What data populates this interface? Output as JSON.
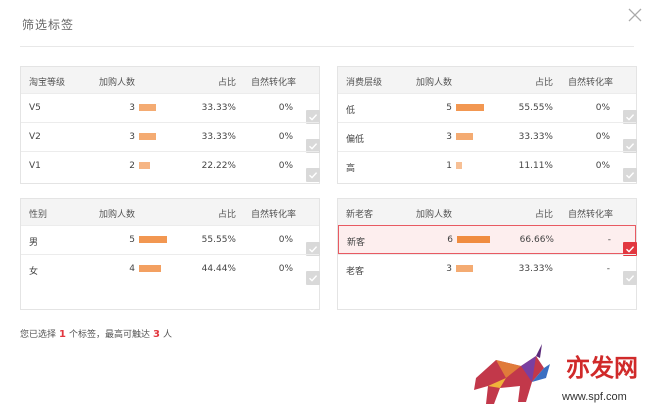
{
  "dialog": {
    "title": "筛选标签"
  },
  "panels": {
    "taobao": {
      "headers": [
        "淘宝等级",
        "加购人数",
        "占比",
        "自然转化率"
      ],
      "rows": [
        {
          "label": "V5",
          "count": "3",
          "pct": "33.33%",
          "rate": "0%",
          "share": 0.3333,
          "checked": false
        },
        {
          "label": "V2",
          "count": "3",
          "pct": "33.33%",
          "rate": "0%",
          "share": 0.3333,
          "checked": false
        },
        {
          "label": "V1",
          "count": "2",
          "pct": "22.22%",
          "rate": "0%",
          "share": 0.2222,
          "checked": false
        }
      ]
    },
    "consume": {
      "headers": [
        "消费层级",
        "加购人数",
        "占比",
        "自然转化率"
      ],
      "rows": [
        {
          "label": "低",
          "count": "5",
          "pct": "55.55%",
          "rate": "0%",
          "share": 0.5555,
          "checked": false
        },
        {
          "label": "偏低",
          "count": "3",
          "pct": "33.33%",
          "rate": "0%",
          "share": 0.3333,
          "checked": false
        },
        {
          "label": "高",
          "count": "1",
          "pct": "11.11%",
          "rate": "0%",
          "share": 0.1111,
          "checked": false
        }
      ]
    },
    "gender": {
      "headers": [
        "性别",
        "加购人数",
        "占比",
        "自然转化率"
      ],
      "rows": [
        {
          "label": "男",
          "count": "5",
          "pct": "55.55%",
          "rate": "0%",
          "share": 0.5555,
          "checked": false
        },
        {
          "label": "女",
          "count": "4",
          "pct": "44.44%",
          "rate": "0%",
          "share": 0.4444,
          "checked": false
        }
      ]
    },
    "newold": {
      "headers": [
        "新老客",
        "加购人数",
        "占比",
        "自然转化率"
      ],
      "rows": [
        {
          "label": "新客",
          "count": "6",
          "pct": "66.66%",
          "rate": "-",
          "share": 0.6666,
          "checked": true
        },
        {
          "label": "老客",
          "count": "3",
          "pct": "33.33%",
          "rate": "-",
          "share": 0.3333,
          "checked": false
        }
      ]
    }
  },
  "footer": {
    "prefix": "您已选择",
    "selected_count": "1",
    "middle": "个标签，最高可触达",
    "reach_count": "3",
    "suffix": "人"
  },
  "colors": {
    "bar": "#f08a3c",
    "accent": "#e2373f"
  },
  "watermark": {
    "text": "亦发网",
    "url": "www.spf.com"
  }
}
